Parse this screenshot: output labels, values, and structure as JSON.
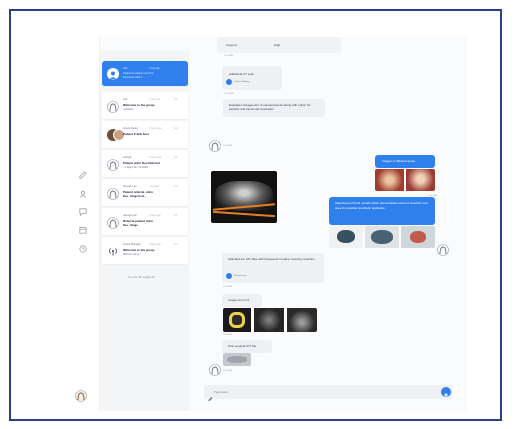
{
  "conversations": [
    {
      "name": "Lab",
      "time": "2 min ago",
      "title": "",
      "subtitle": "Please let patient Lee from",
      "subtitle2": "Encounter with 2 ...",
      "count": ""
    },
    {
      "name": "Lab",
      "time": "1 hour ago",
      "title": "Welcome to the group",
      "subtitle": "Updated...",
      "count": "1/2"
    },
    {
      "name": "Grade Kenny",
      "time": "2 hours ago",
      "title": "Patient Frank Kerr",
      "subtitle": "",
      "count": "1/2"
    },
    {
      "name": "George",
      "time": "3 hours ago",
      "title": "Patient John Doe Referral",
      "subtitle": "- Image from 10.2020",
      "count": "1/2"
    },
    {
      "name": "George Lee",
      "time": "Yesterday",
      "title": "Patient referral, John",
      "subtitle": "Doe - Image from...",
      "count": "1/2"
    },
    {
      "name": "George Lee",
      "time": "2 days ago",
      "title": "Referral patient John",
      "subtitle": "Doe - Image",
      "count": "1/2"
    },
    {
      "name": "Group Manager",
      "time": "3 days ago",
      "title": "Welcome to the group",
      "subtitle": "We'll be using...",
      "count": "1/2"
    }
  ],
  "list_footer": "You are all caught up!",
  "chat": {
    "table": {
      "label": "Urgency",
      "value": "High",
      "time": "10:45 AM"
    },
    "additional_ct": {
      "text": "Additional CT scan",
      "meta": "Sarah Goldberg",
      "time": "10:45 AM"
    },
    "evaluate": {
      "text": "Evaluate management of exposed areas along with option for esthetic and functional restoration",
      "time": "10:46 AM"
    },
    "images_label": {
      "text": "Images of affected areas",
      "time": "10:47 AM"
    },
    "attached_long": {
      "text": "Attached you'll find models which demonstrate extent of resection and area for possible prosthetic appliance",
      "time": "10:48 AM"
    },
    "attached_stl": {
      "text": "Attached are STL files with framework in place covering resection",
      "meta": "Manufacturer",
      "time": "10:49 AM"
    },
    "images_ct": {
      "text": "Images from CT",
      "time": "10:50 AM"
    },
    "post_surgical": {
      "text": "Post surgical STL file",
      "time": "10:51 AM"
    }
  },
  "composer": {
    "placeholder": "Type here..."
  },
  "colors": {
    "accent": "#2f80ed",
    "border": "#2b3e8c"
  }
}
